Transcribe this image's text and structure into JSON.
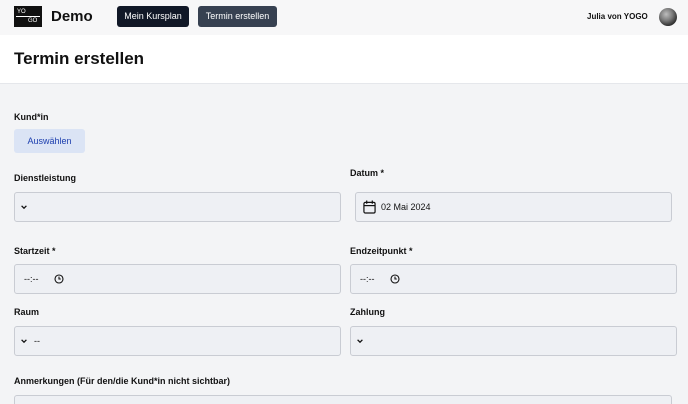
{
  "header": {
    "logo": {
      "top": "YO",
      "bottom": "GO"
    },
    "brand": "Demo",
    "nav": {
      "kursplan": "Mein Kursplan",
      "termin": "Termin erstellen"
    },
    "user": "Julia von YOGO"
  },
  "page": {
    "title": "Termin erstellen"
  },
  "form": {
    "kunde": {
      "label": "Kund*in",
      "button": "Auswählen"
    },
    "dienstleistung": {
      "label": "Dienstleistung",
      "value": ""
    },
    "datum": {
      "label": "Datum *",
      "value": "02 Mai 2024"
    },
    "startzeit": {
      "label": "Startzeit *",
      "value": "--:--"
    },
    "endzeitpunkt": {
      "label": "Endzeitpunkt *",
      "value": "--:--"
    },
    "raum": {
      "label": "Raum",
      "value": "--"
    },
    "zahlung": {
      "label": "Zahlung",
      "value": ""
    },
    "anmerkungen": {
      "label": "Anmerkungen (Für den/die Kund*in nicht sichtbar)",
      "value": ""
    }
  }
}
